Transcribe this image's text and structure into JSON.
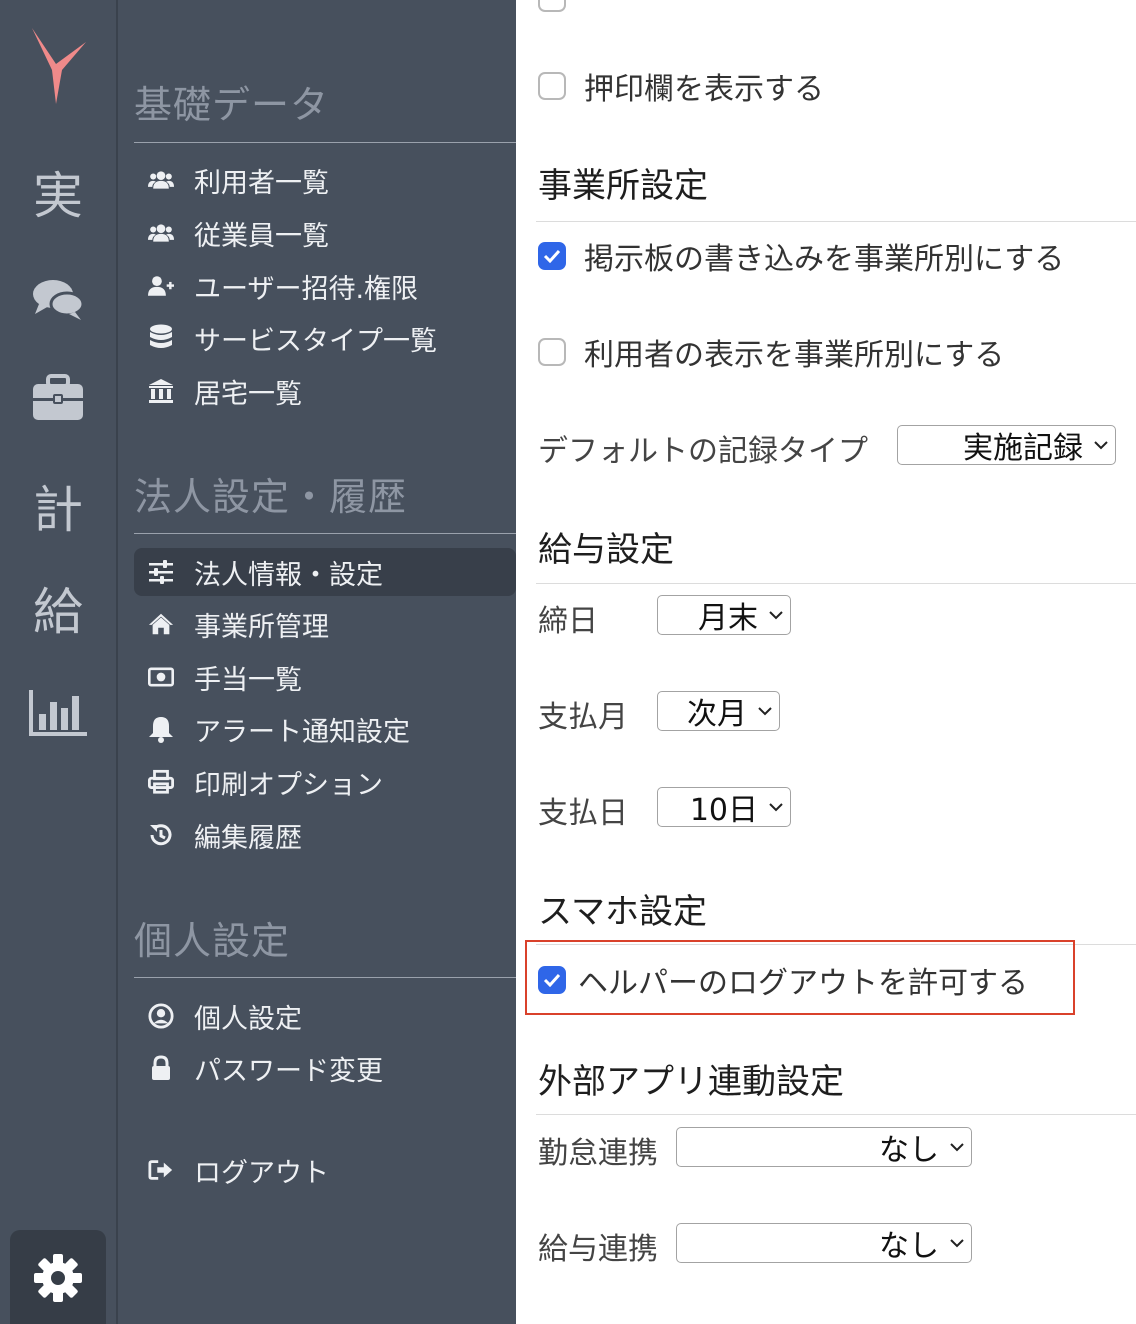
{
  "rail": {
    "items": [
      "実",
      "計",
      "給"
    ]
  },
  "menu": {
    "sections": [
      {
        "title": "基礎データ",
        "items": [
          {
            "label": "利用者一覧",
            "icon": "users-icon"
          },
          {
            "label": "従業員一覧",
            "icon": "users-icon"
          },
          {
            "label": "ユーザー招待.権限",
            "icon": "user-plus-icon"
          },
          {
            "label": "サービスタイプ一覧",
            "icon": "database-icon"
          },
          {
            "label": "居宅一覧",
            "icon": "bank-icon"
          }
        ]
      },
      {
        "title": "法人設定・履歴",
        "items": [
          {
            "label": "法人情報・設定",
            "icon": "sliders-icon",
            "active": true
          },
          {
            "label": "事業所管理",
            "icon": "home-icon"
          },
          {
            "label": "手当一覧",
            "icon": "money-icon"
          },
          {
            "label": "アラート通知設定",
            "icon": "bell-icon"
          },
          {
            "label": "印刷オプション",
            "icon": "print-icon"
          },
          {
            "label": "編集履歴",
            "icon": "history-icon"
          }
        ]
      },
      {
        "title": "個人設定",
        "items": [
          {
            "label": "個人設定",
            "icon": "user-circle-icon"
          },
          {
            "label": "パスワード変更",
            "icon": "lock-icon"
          }
        ]
      }
    ],
    "logout": "ログアウト"
  },
  "content": {
    "stamp_checkbox": {
      "label": "押印欄を表示する",
      "checked": false
    },
    "office": {
      "title": "事業所設定",
      "board_by_office": {
        "label": "掲示板の書き込みを事業所別にする",
        "checked": true
      },
      "users_by_office": {
        "label": "利用者の表示を事業所別にする",
        "checked": false
      },
      "default_record_type": {
        "label": "デフォルトの記録タイプ",
        "value": "実施記録"
      }
    },
    "salary": {
      "title": "給与設定",
      "closing_day": {
        "label": "締日",
        "value": "月末"
      },
      "pay_month": {
        "label": "支払月",
        "value": "次月"
      },
      "pay_day": {
        "label": "支払日",
        "value": "10日"
      }
    },
    "phone": {
      "title": "スマホ設定",
      "allow_logout": {
        "label": "ヘルパーのログアウトを許可する",
        "checked": true
      }
    },
    "external": {
      "title": "外部アプリ連動設定",
      "attendance": {
        "label": "勤怠連携",
        "value": "なし"
      },
      "payroll": {
        "label": "給与連携",
        "value": "なし"
      }
    }
  },
  "colors": {
    "sidebar": "#47505d",
    "accent_checkbox": "#2f66e8",
    "highlight_border": "#d9412b",
    "logo": "#f08a8a"
  }
}
